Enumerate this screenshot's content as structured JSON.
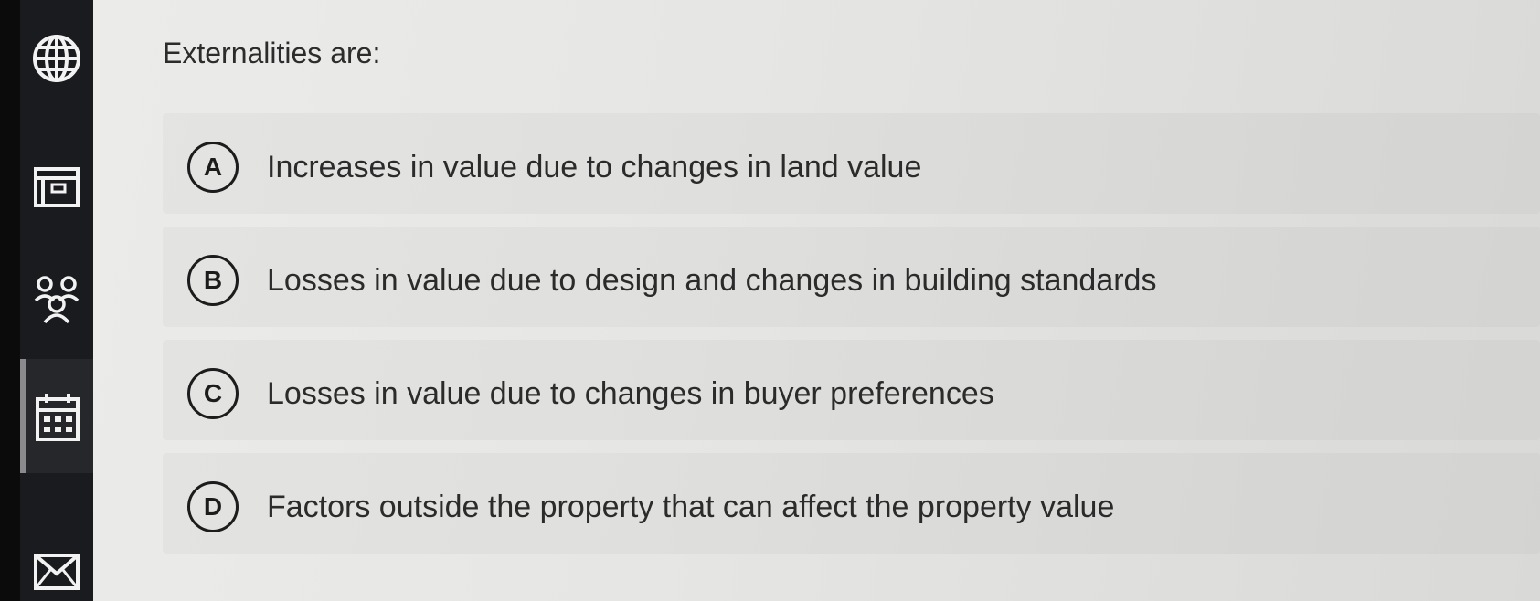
{
  "question": {
    "text": "Externalities are:"
  },
  "options": [
    {
      "letter": "A",
      "text": "Increases in value due to changes in land value"
    },
    {
      "letter": "B",
      "text": "Losses in value due to design and changes in building standards"
    },
    {
      "letter": "C",
      "text": "Losses in value due to changes in buyer preferences"
    },
    {
      "letter": "D",
      "text": "Factors outside the property that can affect the property value"
    }
  ],
  "sidebar": {
    "items": [
      {
        "icon": "globe-icon",
        "active": false
      },
      {
        "icon": "document-icon",
        "active": false
      },
      {
        "icon": "people-icon",
        "active": false
      },
      {
        "icon": "calendar-icon",
        "active": true
      },
      {
        "icon": "mail-icon",
        "active": false
      }
    ]
  },
  "colors": {
    "sidebar_bg": "#1a1b1e",
    "content_bg": "#e8e8e6",
    "text": "#2b2b2b",
    "icon": "#f2f2f2"
  }
}
